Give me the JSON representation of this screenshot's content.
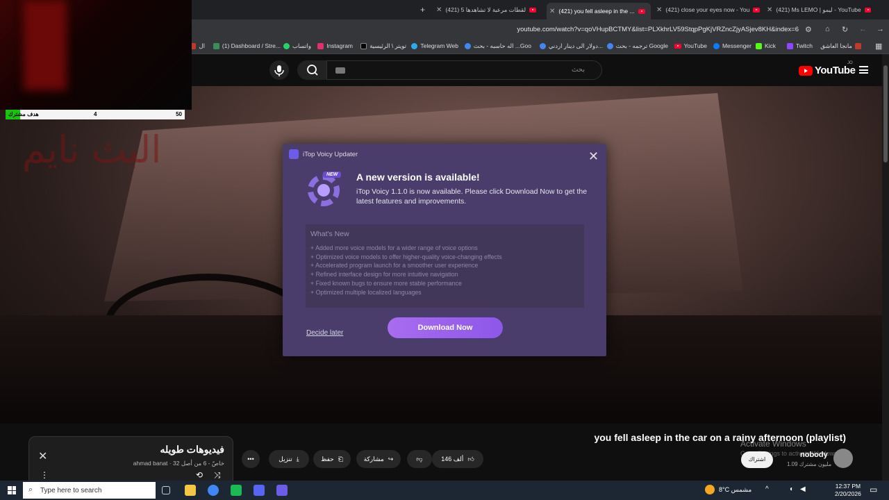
{
  "browser": {
    "tabs": [
      {
        "title": "(421) Ms LEMO | ليمو - YouTube"
      },
      {
        "title": "(421) close your eyes now - You"
      },
      {
        "title": "(421) you fell asleep in the ..."
      },
      {
        "title": "(421) 5 لقطات مرعبة لا تشاهدها"
      }
    ],
    "new_tab": "+",
    "url": "youtube.com/watch?v=qoVHupBCTMY&list=PLXkhrLV59StqpPgKjVRZncZjyASjev8KH&index=6",
    "bookmarks": [
      "مانجا العاشق",
      "Twitch",
      "Kick",
      "Messenger",
      "YouTube",
      "ترجمه - بحث Google",
      "دولار الى دينار اردني...",
      "اله حاسبه - بحث ...Goo",
      "Telegram Web",
      "تويتر \\ الرئيسية",
      "Instagram",
      "واتساب",
      "(1) Dashboard / Stre...",
      "ال"
    ]
  },
  "youtube": {
    "logo_text": "YouTube",
    "region": "JO",
    "search_placeholder": "بحث"
  },
  "overlay": {
    "goal_label": "هدف مشترك",
    "goal_current": "4",
    "goal_target": "50",
    "goal_progress": 0.08,
    "watermark": "البث نايم"
  },
  "dialog": {
    "window_title": "iTop Voicy Updater",
    "badge": "NEW",
    "heading": "A new version is available!",
    "description": "iTop Voicy 1.1.0 is now available. Please click Download Now to get the latest features and improvements.",
    "whats_new_title": "What's New",
    "items": [
      "+ Added more voice models for a wider range of voice options",
      "+ Optimized voice models to offer higher-quality voice-changing effects",
      "+ Accelerated program launch for a smoother user experience",
      "+ Refined interface design for more intuitive navigation",
      "+ Fixed known bugs to ensure more stable performance",
      "+ Optimized multiple localized languages"
    ],
    "decide_later": "Decide later",
    "download_now": "Download Now"
  },
  "video_info": {
    "title": "you fell asleep in the car on a rainy afternoon (playlist)",
    "channel": "nobody",
    "subscribers": "1.09 مليون مشترك",
    "subscribe": "اشتراك",
    "likes": "146 ألف",
    "share": "مشاركة",
    "save": "حفظ",
    "download": "تنزيل",
    "more": "•••"
  },
  "playlist": {
    "title": "فيديوهات طويله",
    "meta": "ahmad banat · خاصّ - 6 من أصل 32"
  },
  "windows": {
    "activate_title": "Activate Windows",
    "activate_sub": "Go to Settings to activate Windows.",
    "search_placeholder": "Type here to search",
    "weather": "8°C  مشمس",
    "time": "12:37 PM",
    "date": "2/20/2026"
  }
}
